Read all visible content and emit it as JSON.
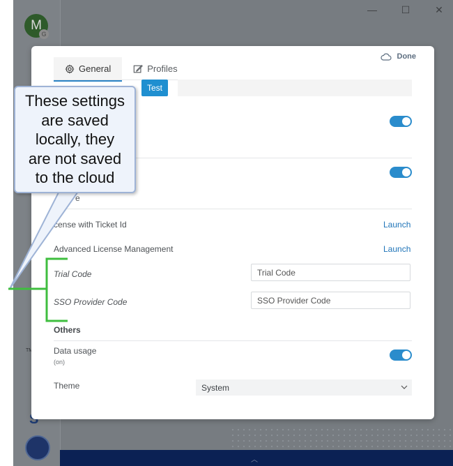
{
  "app": {
    "avatar_initial": "M",
    "avatar_badge": "G",
    "window_controls": [
      "—",
      "☐",
      "✕"
    ],
    "side_mark": "S",
    "side_tm": "TM",
    "bottom_chevron": "︿"
  },
  "dialog": {
    "tabs": [
      {
        "label": "General",
        "icon": "gear-icon",
        "active": true
      },
      {
        "label": "Profiles",
        "icon": "edit-icon",
        "active": false
      }
    ],
    "done_label": "Done",
    "done_icon": "cloud-icon",
    "test_badge": "Test",
    "rows": {
      "license_ticket": {
        "label": "License with Ticket Id",
        "visible_label": "cense with Ticket Id",
        "action": "Launch"
      },
      "advanced_license": {
        "label": "Advanced License Management",
        "action": "Launch"
      },
      "trial_code": {
        "label": "Trial Code",
        "placeholder": "Trial Code"
      },
      "sso_provider": {
        "label": "SSO Provider Code",
        "placeholder": "SSO Provider Code"
      },
      "partial_section": "e"
    },
    "others": {
      "section_title": "Others",
      "data_usage": {
        "label": "Data usage",
        "status": "(on)",
        "enabled": true
      },
      "theme": {
        "label": "Theme",
        "value": "System"
      }
    },
    "toggles": {
      "toggle_1": true,
      "toggle_2": true
    }
  },
  "callout": {
    "lines": [
      "These settings",
      "are saved",
      "locally, they",
      "are not saved",
      "to the cloud"
    ],
    "border_color": "#9eb3d6",
    "bracket_color": "#3fbe3f"
  },
  "colors": {
    "accent": "#2a8ccc",
    "link": "#1f74b8",
    "badge": "#1f8fd0"
  }
}
